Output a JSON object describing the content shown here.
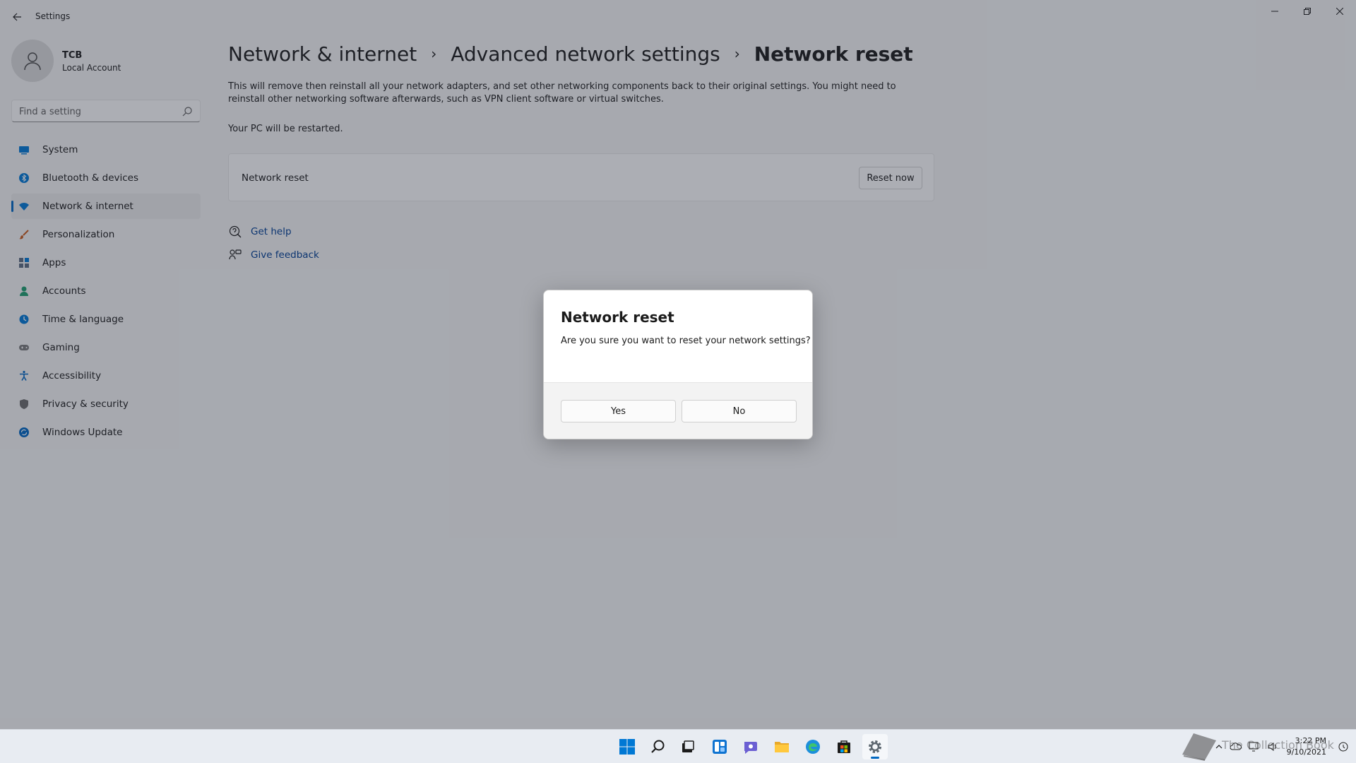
{
  "window": {
    "title": "Settings"
  },
  "profile": {
    "name": "TCB",
    "account_type": "Local Account"
  },
  "search": {
    "placeholder": "Find a setting"
  },
  "sidebar": {
    "items": [
      {
        "label": "System",
        "icon": "monitor-icon",
        "color": "#0078d4"
      },
      {
        "label": "Bluetooth & devices",
        "icon": "bluetooth-icon",
        "color": "#0078d4"
      },
      {
        "label": "Network & internet",
        "icon": "wifi-icon",
        "color": "#0078d4",
        "selected": true
      },
      {
        "label": "Personalization",
        "icon": "brush-icon",
        "color": "#c75a1b"
      },
      {
        "label": "Apps",
        "icon": "apps-icon",
        "color": "#5b6b7f"
      },
      {
        "label": "Accounts",
        "icon": "person-icon",
        "color": "#1f9d6e"
      },
      {
        "label": "Time & language",
        "icon": "globe-clock-icon",
        "color": "#0078d4"
      },
      {
        "label": "Gaming",
        "icon": "gamepad-icon",
        "color": "#7a7a7a"
      },
      {
        "label": "Accessibility",
        "icon": "accessibility-icon",
        "color": "#0067c0"
      },
      {
        "label": "Privacy & security",
        "icon": "shield-icon",
        "color": "#6b6b6b"
      },
      {
        "label": "Windows Update",
        "icon": "update-icon",
        "color": "#0067c0"
      }
    ]
  },
  "breadcrumb": {
    "items": [
      "Network & internet",
      "Advanced network settings",
      "Network reset"
    ],
    "separator": "›"
  },
  "main": {
    "description": "This will remove then reinstall all your network adapters, and set other networking components back to their original settings. You might need to reinstall other networking software afterwards, such as VPN client software or virtual switches.",
    "restart_note": "Your PC will be restarted.",
    "card_label": "Network reset",
    "reset_button": "Reset now",
    "get_help": "Get help",
    "give_feedback": "Give feedback"
  },
  "dialog": {
    "title": "Network reset",
    "message": "Are you sure you want to reset your network settings?",
    "yes": "Yes",
    "no": "No"
  },
  "taskbar": {
    "apps": [
      "start-icon",
      "search-icon",
      "task-view-icon",
      "widgets-icon",
      "chat-icon",
      "file-explorer-icon",
      "edge-icon",
      "store-icon",
      "settings-icon"
    ],
    "time": "3:22 PM",
    "date": "9/10/2021",
    "watermark": "The Collection Book"
  },
  "colors": {
    "accent": "#0067c0",
    "link": "#003e92",
    "background": "#f3f3f3"
  }
}
